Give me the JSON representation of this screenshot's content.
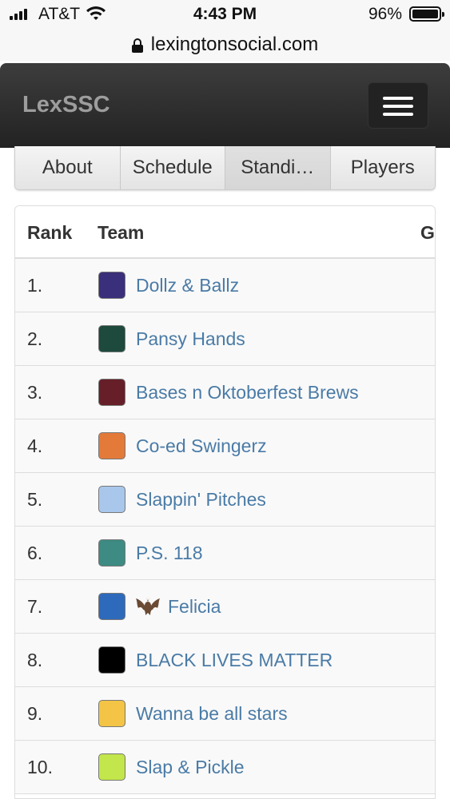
{
  "status": {
    "carrier": "AT&T",
    "time": "4:43 PM",
    "battery": "96%"
  },
  "browser": {
    "url": "lexingtonsocial.com"
  },
  "navbar": {
    "brand": "LexSSC",
    "menu_icon": "hamburger-menu-icon"
  },
  "tabs": [
    {
      "label": "About",
      "active": false
    },
    {
      "label": "Schedule",
      "active": false
    },
    {
      "label": "Standi…",
      "active": true
    },
    {
      "label": "Players",
      "active": false
    }
  ],
  "table": {
    "headers": [
      "Rank",
      "Team",
      "G"
    ],
    "rows": [
      {
        "rank": "1.",
        "team": "Dollz & Ballz",
        "color": "#3a2f7a"
      },
      {
        "rank": "2.",
        "team": "Pansy Hands",
        "color": "#1d4a3c"
      },
      {
        "rank": "3.",
        "team": "Bases n Oktoberfest Brews",
        "color": "#661f28"
      },
      {
        "rank": "4.",
        "team": "Co-ed Swingerz",
        "color": "#e37a3a"
      },
      {
        "rank": "5.",
        "team": "Slappin' Pitches",
        "color": "#a9c7eb"
      },
      {
        "rank": "6.",
        "team": "P.S. 118",
        "color": "#3d8b83"
      },
      {
        "rank": "7.",
        "team": "Felicia",
        "color": "#2e6abb",
        "icon": "bat-icon"
      },
      {
        "rank": "8.",
        "team": "BLACK LIVES MATTER",
        "color": "#000000"
      },
      {
        "rank": "9.",
        "team": "Wanna be all stars",
        "color": "#f3c445"
      },
      {
        "rank": "10.",
        "team": "Slap & Pickle",
        "color": "#c2e64b"
      }
    ]
  }
}
